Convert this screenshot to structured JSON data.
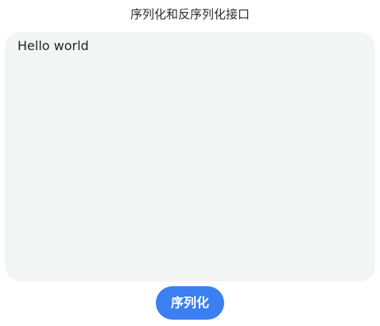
{
  "page": {
    "title": "序列化和反序列化接口"
  },
  "editor": {
    "text": "Hello world"
  },
  "actions": {
    "serialize_label": "序列化"
  },
  "colors": {
    "accent": "#3b7ff0",
    "editor_background": "#f3f4f4"
  }
}
